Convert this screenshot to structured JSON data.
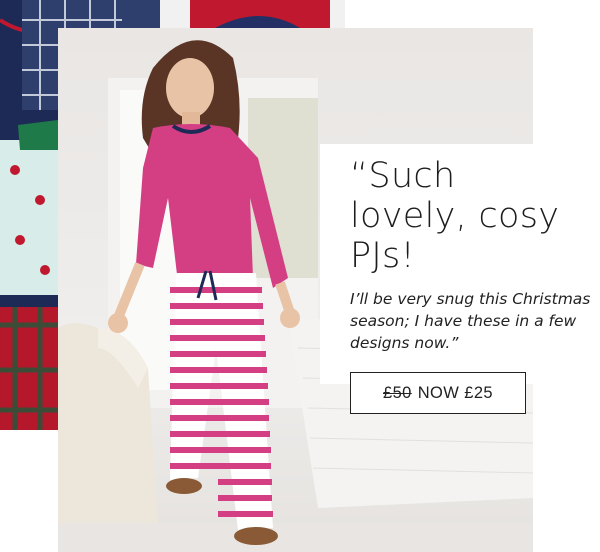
{
  "promo": {
    "quote": "“Such lovely, cosy PJs!",
    "testimonial": "I’ll be very snug this Christmas season; I have these in a few designs now.”",
    "price_old": "£50",
    "price_new": "NOW £25"
  },
  "colors": {
    "navy": "#1d2a55",
    "pink": "#d43f84",
    "red": "#c0182e",
    "green": "#1f7a4a",
    "mint": "#d8ede9",
    "card_text": "#1d1d1d"
  }
}
